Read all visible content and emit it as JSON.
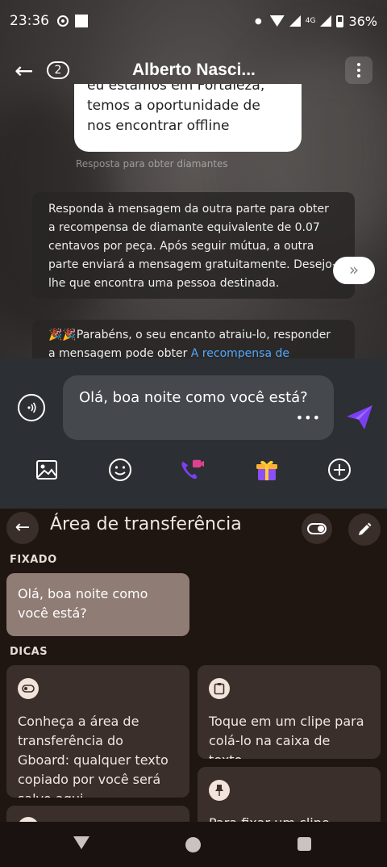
{
  "status_bar": {
    "time": "23:36",
    "network": "4G",
    "battery": "36%"
  },
  "header": {
    "back_icon": "arrow-left-icon",
    "unread_count": "2",
    "contact_name": "Alberto Nasci..."
  },
  "messages": {
    "incoming_top_clipped": "eu estamos em Fortaleza,",
    "incoming_text": "temos a oportunidade de nos encontrar offline",
    "reward_hint": "Resposta para obter diamantes",
    "system_notice": "Responda à mensagem da outra parte para obter a recompensa de diamante equivalente de 0.07 centavos por peça. Após seguir mútua, a outra parte enviará a mensagem gratuitamente. Desejo-lhe que encontra uma pessoa destinada.",
    "expand_label": "»",
    "congrats_emoji": "🎉🎉",
    "congrats_text": "Parabéns, o seu encanto atraiu-lo, responder a mensagem pode obter ",
    "congrats_link": "A recompensa de diamante"
  },
  "composer": {
    "input_value": "Olá, boa noite como você está?",
    "more_dots": "•••"
  },
  "toolbar": {
    "items": [
      "image-icon",
      "emoji-icon",
      "video-call-icon",
      "gift-icon",
      "add-icon"
    ]
  },
  "clipboard": {
    "title": "Área de transferência",
    "pinned_label": "FIXADO",
    "pinned_clip": "Olá, boa noite como você está?",
    "tips_label": "DICAS",
    "tip_1": "Conheça a área de transferência do Gboard: qualquer texto copiado por você será salvo aqui.",
    "tip_2": "Toque em um clipe para colá-lo na caixa de texto.",
    "tip_3": "Para fixar um clipe"
  },
  "colors": {
    "accent_purple": "#7b3ff2",
    "link_blue": "#4fa8ff",
    "keyboard_bg": "#1f1511"
  }
}
